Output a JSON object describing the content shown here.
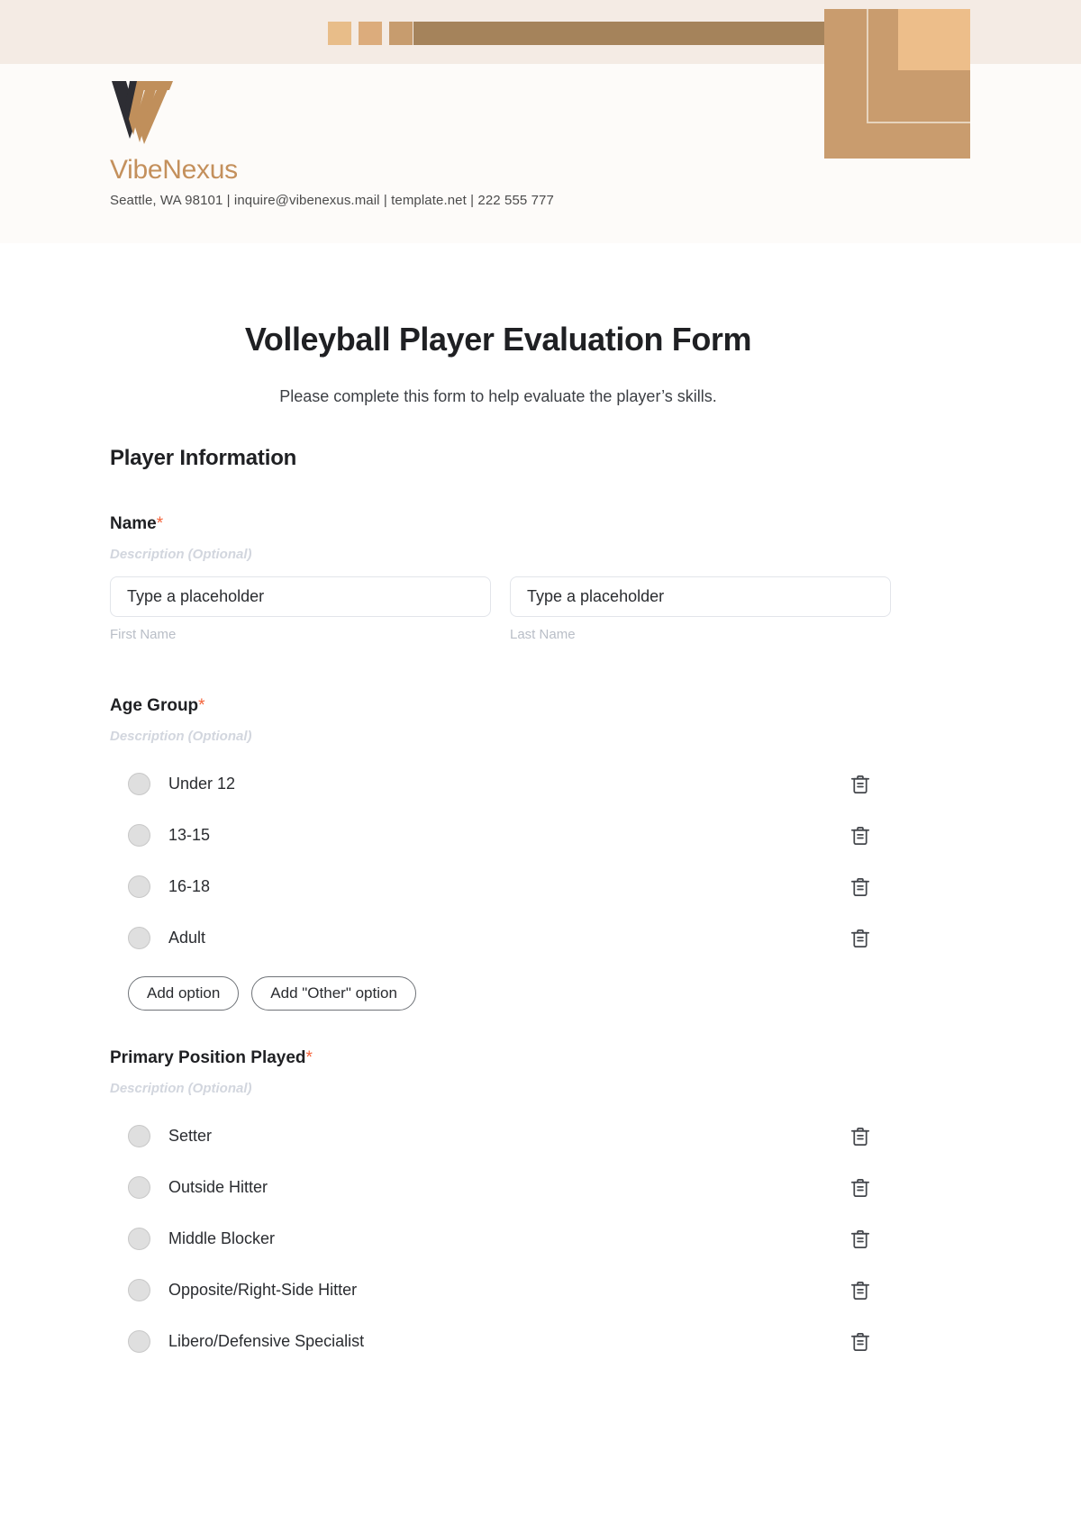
{
  "brand": {
    "name": "VibeNexus",
    "contact": "Seattle, WA 98101 | inquire@vibenexus.mail | template.net | 222 555 777",
    "accent_color": "#C4905C",
    "bar_color": "#A5835B",
    "block_color": "#C99C6E",
    "light_block_color": "#EDBE8A"
  },
  "form": {
    "title": "Volleyball Player Evaluation Form",
    "subtitle": "Please complete this form to help evaluate the player’s skills.",
    "section_heading": "Player Information",
    "required_marker": "*",
    "required_color": "#F4633A",
    "description_placeholder": "Description (Optional)"
  },
  "fields": [
    {
      "label": "Name",
      "required": true,
      "description": "Description (Optional)",
      "type": "name",
      "inputs": [
        {
          "placeholder": "Type a placeholder",
          "value": "",
          "sub_label": "First Name"
        },
        {
          "placeholder": "Type a placeholder",
          "value": "",
          "sub_label": "Last Name"
        }
      ]
    },
    {
      "label": "Age Group",
      "required": true,
      "description": "Description (Optional)",
      "type": "radio",
      "options": [
        "Under 12",
        "13-15",
        "16-18",
        "Adult"
      ],
      "add_buttons": [
        "Add option",
        "Add \"Other\" option"
      ]
    },
    {
      "label": "Primary Position Played",
      "required": true,
      "description": "Description (Optional)",
      "type": "radio",
      "options": [
        "Setter",
        "Outside Hitter",
        "Middle Blocker",
        "Opposite/Right-Side Hitter",
        "Libero/Defensive Specialist"
      ]
    }
  ],
  "icons": {
    "delete": "trash-icon"
  }
}
